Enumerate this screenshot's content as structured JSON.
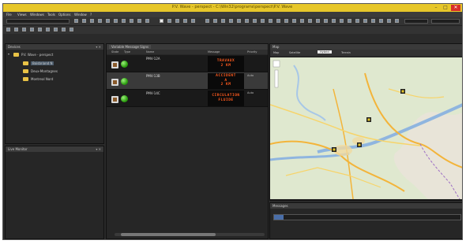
{
  "window": {
    "title": "P.V. Wave - perspect - C:\\Win32\\programs\\perspect\\P.V. Wave",
    "menu": [
      "File",
      "Views",
      "Windows",
      "Tools",
      "Options",
      "Window",
      "?"
    ]
  },
  "devices_panel": {
    "header": "Devices",
    "root": "P.V. Wave - perspect",
    "items": [
      "Boisbriand N",
      "Deux-Montagnes",
      "Montreal Nord"
    ]
  },
  "lower_left_panel": {
    "header": "Live Monitor"
  },
  "grid": {
    "header": "Variable Message Signs",
    "columns": [
      "State",
      "Type",
      "Name",
      "Message",
      "Priority"
    ],
    "rows": [
      {
        "name": "PMV-12A",
        "message": "TRAVAUX / 2 KM",
        "tag": ""
      },
      {
        "name": "PMV-13B",
        "message": "ACCIDENT / A / 2 KM",
        "tag": "Auto"
      },
      {
        "name": "PMV-14C",
        "message": "CIRCULATION / FLUIDE",
        "tag": "Auto"
      }
    ]
  },
  "map_panel": {
    "header": "Map",
    "tabs": [
      "Map",
      "Satellite",
      "Hybrid",
      "Terrain"
    ]
  },
  "messages_panel": {
    "header": "Messages",
    "value": ""
  },
  "colors": {
    "titlebar": "#e7c72a",
    "sign_led": "#ff5a1e",
    "status_ok": "#2ea012"
  }
}
